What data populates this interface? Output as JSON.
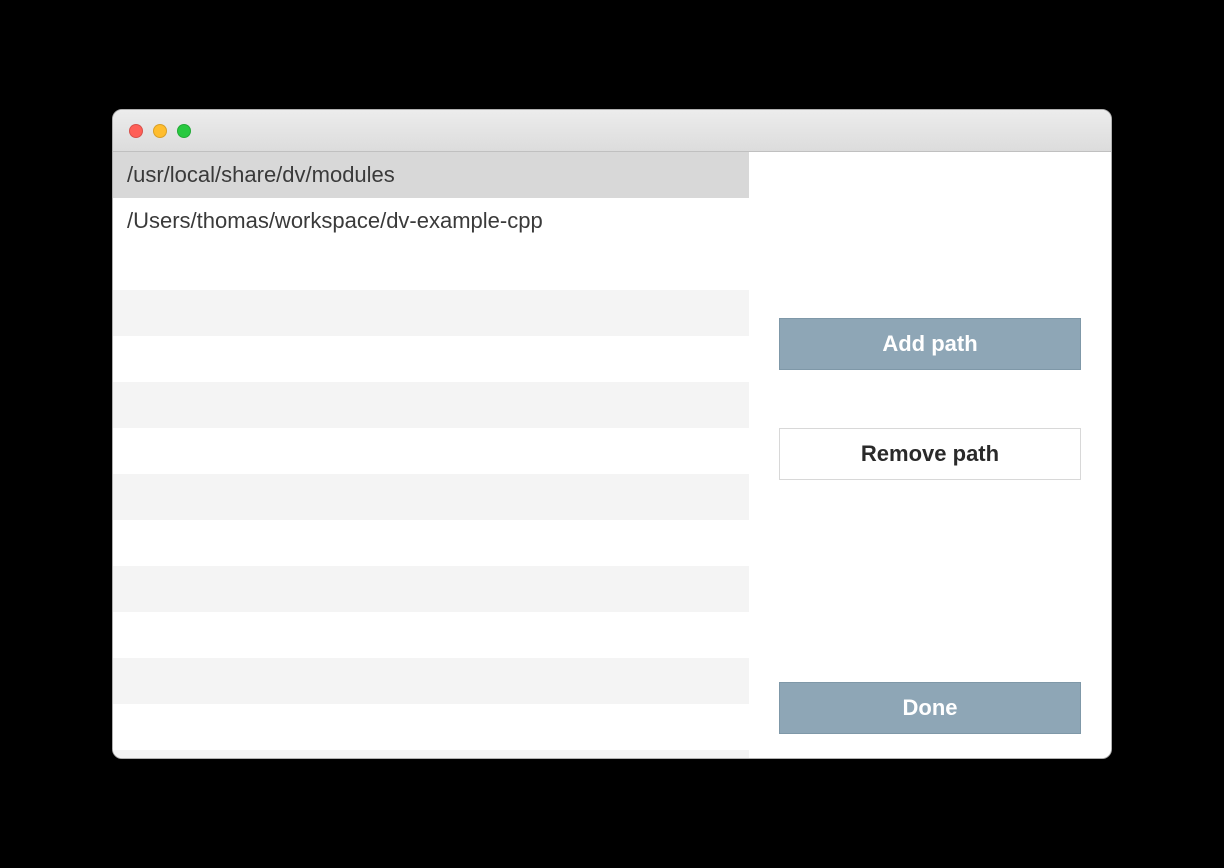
{
  "paths": {
    "items": [
      {
        "path": "/usr/local/share/dv/modules",
        "selected": true
      },
      {
        "path": "/Users/thomas/workspace/dv-example-cpp",
        "selected": false
      }
    ]
  },
  "buttons": {
    "add_path": "Add path",
    "remove_path": "Remove path",
    "done": "Done"
  }
}
